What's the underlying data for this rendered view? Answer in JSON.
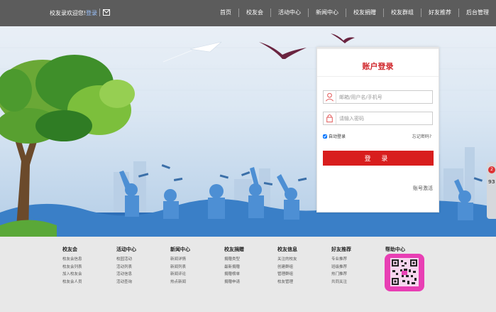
{
  "header": {
    "welcome": "校友录欢迎您!",
    "login_link": "登录",
    "mail_icon": "mail-icon",
    "nav": [
      "首页",
      "校友会",
      "活动中心",
      "新闻中心",
      "校友捐赠",
      "校友群组",
      "好友推荐",
      "后台管理"
    ]
  },
  "login": {
    "title": "账户登录",
    "username_placeholder": "邮箱/用户名/手机号",
    "password_placeholder": "请输入密码",
    "remember_label": "自动登录",
    "remember_checked": true,
    "forgot_label": "忘记密码?",
    "submit_label": "登 录",
    "activate_label": "账号激活"
  },
  "side_widget": {
    "badge": "2",
    "number": "93"
  },
  "footer": {
    "columns": [
      {
        "title": "校友会",
        "items": [
          "校友会信息",
          "校友会列表",
          "加入校友会",
          "校友会人员"
        ]
      },
      {
        "title": "活动中心",
        "items": [
          "校园活动",
          "活动列表",
          "活动信息",
          "活动查询"
        ]
      },
      {
        "title": "新闻中心",
        "items": [
          "新闻详情",
          "新闻列表",
          "新闻评论",
          "热点新闻"
        ]
      },
      {
        "title": "校友捐赠",
        "items": [
          "捐赠类型",
          "最新捐赠",
          "捐赠榜单",
          "捐赠申请"
        ]
      },
      {
        "title": "校友信息",
        "items": [
          "关注的校友",
          "创建群组",
          "管理群组",
          "校友管理"
        ]
      },
      {
        "title": "好友推荐",
        "items": [
          "专业推荐",
          "班级推荐",
          "热门推荐",
          "共同关注"
        ]
      },
      {
        "title": "帮助中心",
        "items": []
      }
    ]
  },
  "colors": {
    "topbar": "#5c5c5c",
    "accent_red": "#d81e1e",
    "title_red": "#d0262b"
  }
}
